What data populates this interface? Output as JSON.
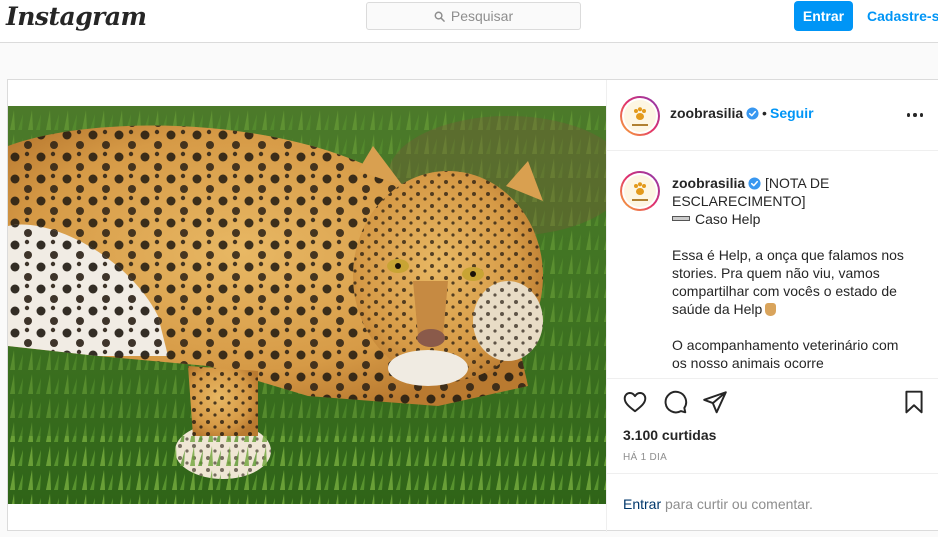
{
  "header": {
    "logo": "Instagram",
    "search_placeholder": "Pesquisar",
    "login_label": "Entrar",
    "signup_label": "Cadastre-se"
  },
  "post": {
    "username": "zoobrasilia",
    "separator": "•",
    "follow_label": "Seguir",
    "caption": {
      "line1": "[NOTA DE ESCLARECIMENTO]",
      "line2": "Caso Help",
      "para1": "Essa é Help, a onça que falamos nos stories. Pra quem não viu, vamos compartilhar com vocês o estado de saúde da Help",
      "para2": "O acompanhamento veterinário com os nosso animais ocorre"
    },
    "likes": "3.100 curtidas",
    "time": "HÁ 1 DIA",
    "footer_login": "Entrar",
    "footer_text": "para curtir ou comentar."
  },
  "icons": [
    "search-icon",
    "verified-badge-icon",
    "more-options-icon",
    "heart-icon",
    "comment-icon",
    "share-icon",
    "bookmark-icon",
    "paw-logo-icon"
  ],
  "colors": {
    "accent": "#0095f6",
    "text": "#262626",
    "muted": "#8e8e8e",
    "border": "#dbdbdb"
  }
}
